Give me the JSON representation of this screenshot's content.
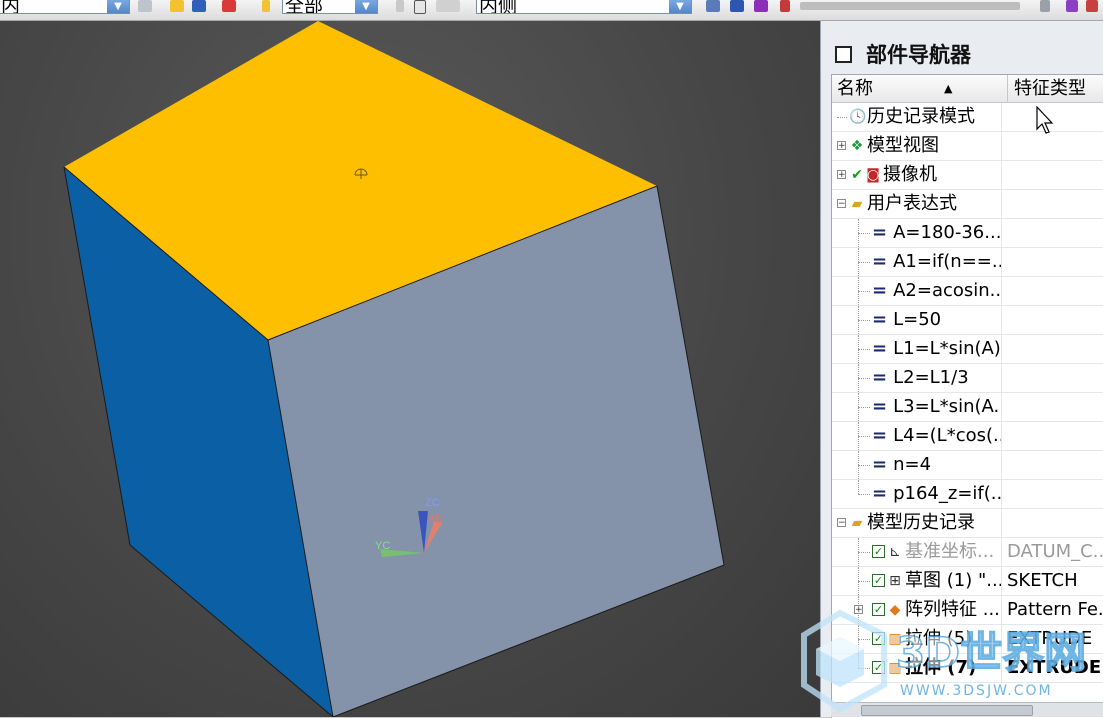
{
  "toolbar": {
    "combo_left": "内",
    "combo_filter": "全部",
    "combo_side": "内侧"
  },
  "navigator": {
    "title": "部件导航器",
    "col_name": "名称",
    "col_type": "特征类型",
    "rows": [
      {
        "label": "历史记录模式",
        "type": ""
      },
      {
        "label": "模型视图",
        "type": ""
      },
      {
        "label": "摄像机",
        "type": ""
      },
      {
        "label": "用户表达式",
        "type": ""
      },
      {
        "label": "A=180-36...",
        "type": ""
      },
      {
        "label": "A1=if(n==...",
        "type": ""
      },
      {
        "label": "A2=acosin...",
        "type": ""
      },
      {
        "label": "L=50",
        "type": ""
      },
      {
        "label": "L1=L*sin(A)",
        "type": ""
      },
      {
        "label": "L2=L1/3",
        "type": ""
      },
      {
        "label": "L3=L*sin(A...",
        "type": ""
      },
      {
        "label": "L4=(L*cos(...",
        "type": ""
      },
      {
        "label": "n=4",
        "type": ""
      },
      {
        "label": "p164_z=if(...",
        "type": ""
      },
      {
        "label": "模型历史记录",
        "type": ""
      },
      {
        "label": "基准坐标...",
        "type": "DATUM_C..."
      },
      {
        "label": "草图 (1) \"...",
        "type": "SKETCH"
      },
      {
        "label": "阵列特征 ...",
        "type": "Pattern Fe..."
      },
      {
        "label": "拉伸 (5)",
        "type": "EXTRUDE"
      },
      {
        "label": "拉伸 (7)",
        "type": "EXTRUDE"
      }
    ]
  },
  "axes": {
    "zc": "ZC",
    "xc": "XC",
    "yc": "YC"
  },
  "watermark": {
    "brand": "3D世界网",
    "url": "WWW.3DSJW.COM"
  },
  "colors": {
    "top_face": "#fdbf00",
    "left_face": "#0a5fa5",
    "front_face": "#8593aa",
    "watermark": "#4aa3df"
  }
}
